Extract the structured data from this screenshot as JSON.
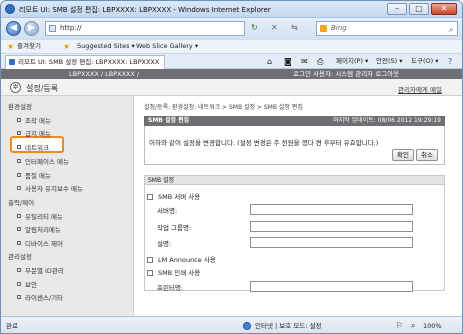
{
  "window": {
    "title": "리모트 UI: SMB 설정 편집: LBPXXXX: LBPXXXX - Windows Internet Explorer",
    "minimize": "–",
    "maximize": "□",
    "close": "✕"
  },
  "address": {
    "back": "◀",
    "forward": "▶",
    "url": "http://",
    "search_placeholder": "Bing"
  },
  "favorites": {
    "label": "즐겨찾기",
    "suggested": "Suggested Sites ▾",
    "web_slice": "Web Slice Gallery ▾"
  },
  "tabs": {
    "active": "리모트 UI: SMB 설정 편집: LBPXXXX: LBPXXXX",
    "commands": [
      "페이지(P) ▾",
      "안전(S) ▾",
      "도구(O) ▾"
    ]
  },
  "app": {
    "device": "LBPXXXX / LBPXXXX /",
    "login_info": "로그인 사용자: 시스템 관리자 로그아웃",
    "section_title": "설정/등록",
    "admin_mail": "관리자에게 메일"
  },
  "sidebar": {
    "groups": [
      {
        "heading": "환경설정",
        "items": [
          "조작 메뉴",
          "급지 메뉴",
          "네트워크",
          "인터페이스 메뉴",
          "품질 메뉴",
          "사용자 유지보수 메뉴"
        ]
      },
      {
        "heading": "출력/제어",
        "items": [
          "유틸리티 메뉴",
          "알림처리메뉴",
          "디바이스 제어"
        ]
      },
      {
        "heading": "관리설정",
        "items": [
          "부문별 ID관리",
          "보안",
          "라이센스/기타"
        ]
      }
    ]
  },
  "main": {
    "breadcrumb": "설정/등록: 환경설정: 네트워크 > SMB 설정 > SMB 설정 편집",
    "panel_title": "SMB 설정 편집",
    "last_updated": "마지막 업데이트: 08/06 2012 19:29:19",
    "message": "이하와 같이 설정을 변경합니다. (설정 변경은 주 전원을 껐다 켠 후부터 유효합니다.)",
    "ok": "확인",
    "cancel": "취소",
    "section_title": "SMB 설정",
    "server_use": "SMB 서버 사용",
    "server_name": "서버명:",
    "workgroup": "작업 그룹명:",
    "comment": "설명:",
    "lm_announce": "LM Announce 사용",
    "print_use": "SMB 인쇄 사용",
    "printer_name": "프린터명:"
  },
  "status": {
    "left": "완료",
    "zone": "인터넷 | 보호 모드: 설정",
    "zoom": "100%"
  }
}
